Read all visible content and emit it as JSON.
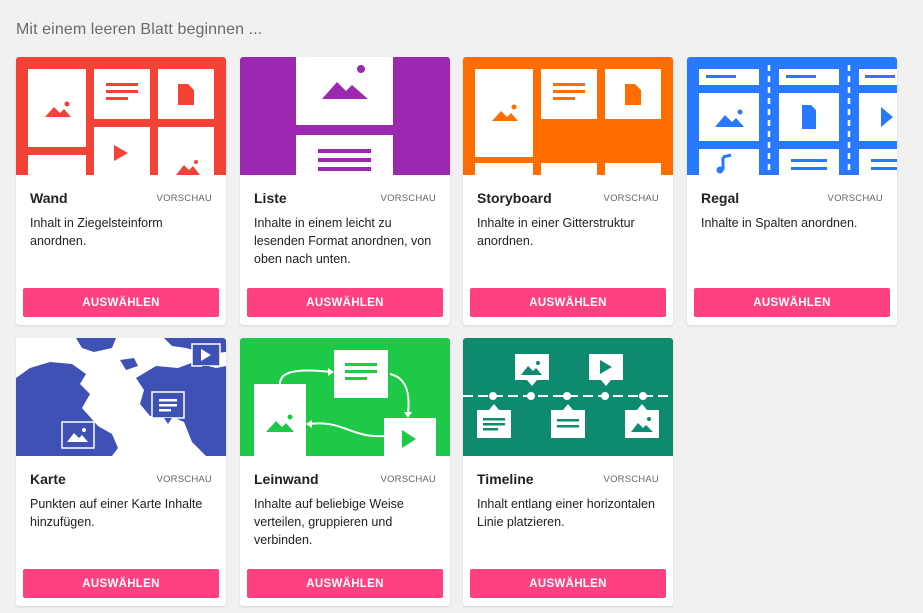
{
  "heading": "Mit einem leeren Blatt beginnen ...",
  "preview_label": "VORSCHAU",
  "select_label": "AUSWÄHLEN",
  "colors": {
    "accent": "#ff4081",
    "wall": "#f44336",
    "list": "#9c27b0",
    "storyboard": "#ff6d00",
    "shelf": "#2979ff",
    "map": "#3f51b5",
    "canvas": "#1ec948",
    "timeline": "#0e8a6f"
  },
  "cards": [
    {
      "title": "Wand",
      "desc": "Inhalt in Ziegelsteinform anordnen.",
      "icon": "wall-layout-icon"
    },
    {
      "title": "Liste",
      "desc": "Inhalte in einem leicht zu lesenden Format anordnen, von oben nach unten.",
      "icon": "list-layout-icon"
    },
    {
      "title": "Storyboard",
      "desc": "Inhalte in einer Gitterstruktur anordnen.",
      "icon": "storyboard-layout-icon"
    },
    {
      "title": "Regal",
      "desc": "Inhalte in Spalten anordnen.",
      "icon": "shelf-layout-icon"
    },
    {
      "title": "Karte",
      "desc": "Punkten auf einer Karte Inhalte hinzufügen.",
      "icon": "map-layout-icon"
    },
    {
      "title": "Leinwand",
      "desc": "Inhalte auf beliebige Weise verteilen, gruppieren und verbinden.",
      "icon": "canvas-layout-icon"
    },
    {
      "title": "Timeline",
      "desc": "Inhalt entlang einer horizontalen Linie platzieren.",
      "icon": "timeline-layout-icon"
    }
  ]
}
